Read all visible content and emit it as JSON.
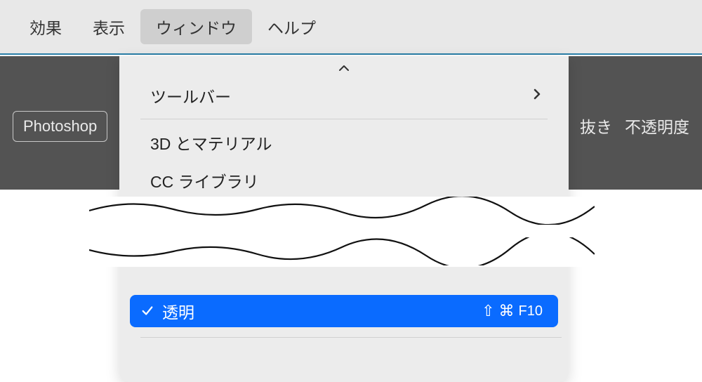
{
  "menubar": {
    "items": [
      {
        "label": "効果"
      },
      {
        "label": "表示"
      },
      {
        "label": "ウィンドウ",
        "active": true
      },
      {
        "label": "ヘルプ"
      }
    ]
  },
  "toolbar": {
    "photoshop_label": "Photoshop",
    "right_label_1": "抜き",
    "right_label_2": "不透明度"
  },
  "dropdown": {
    "toolbar_row": {
      "label": "ツールバー"
    },
    "item_3d": "3D とマテリアル",
    "item_cclib": "CC ライブラリ",
    "highlighted": {
      "label": "透明",
      "shortcut_shift": "⇧",
      "shortcut_cmd": "⌘",
      "shortcut_key": "F10"
    }
  }
}
